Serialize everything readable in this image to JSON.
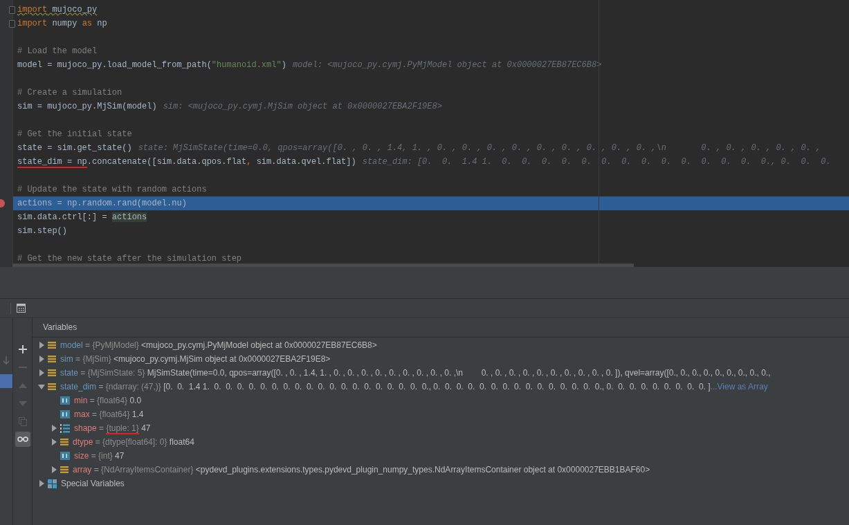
{
  "editor": {
    "lines": [
      {
        "kind": "code",
        "fold": true,
        "current": false,
        "breakpoint": false,
        "tokens": [
          {
            "text": "import",
            "kind": "keyword",
            "squiggle": true
          },
          {
            "text": " mujoco_py",
            "kind": "plain",
            "squiggle": true
          }
        ]
      },
      {
        "kind": "code",
        "fold": true,
        "current": false,
        "breakpoint": false,
        "tokens": [
          {
            "text": "import",
            "kind": "keyword",
            "squiggle": false
          },
          {
            "text": " numpy ",
            "kind": "plain",
            "squiggle": false
          },
          {
            "text": "as",
            "kind": "keyword",
            "squiggle": false
          },
          {
            "text": " np",
            "kind": "plain",
            "squiggle": false
          }
        ]
      },
      {
        "kind": "blank"
      },
      {
        "kind": "code",
        "fold": false,
        "current": false,
        "breakpoint": false,
        "tokens": [
          {
            "text": "# Load the model",
            "kind": "comment"
          }
        ]
      },
      {
        "kind": "code",
        "fold": false,
        "current": false,
        "breakpoint": false,
        "tokens": [
          {
            "text": "model = mujoco_py.load_model_from_path(",
            "kind": "plain"
          },
          {
            "text": "\"humanoid.xml\"",
            "kind": "string"
          },
          {
            "text": ")",
            "kind": "plain"
          }
        ],
        "hint": "model: <mujoco_py.cymj.PyMjModel object at 0x0000027EB87EC6B8>"
      },
      {
        "kind": "blank"
      },
      {
        "kind": "code",
        "fold": false,
        "current": false,
        "breakpoint": false,
        "tokens": [
          {
            "text": "# Create a simulation",
            "kind": "comment"
          }
        ]
      },
      {
        "kind": "code",
        "fold": false,
        "current": false,
        "breakpoint": false,
        "tokens": [
          {
            "text": "sim = mujoco_py.MjSim(model)",
            "kind": "plain"
          }
        ],
        "hint": "sim: <mujoco_py.cymj.MjSim object at 0x0000027EBA2F19E8>"
      },
      {
        "kind": "blank"
      },
      {
        "kind": "code",
        "fold": false,
        "current": false,
        "breakpoint": false,
        "tokens": [
          {
            "text": "# Get the initial state",
            "kind": "comment"
          }
        ]
      },
      {
        "kind": "code",
        "fold": false,
        "current": false,
        "breakpoint": false,
        "tokens": [
          {
            "text": "state = sim.get_state()",
            "kind": "plain"
          }
        ],
        "hint": "state: MjSimState(time=0.0, qpos=array([0. , 0. , 1.4, 1. , 0. , 0. , 0. , 0. , 0. , 0. , 0. , 0. , 0. ,\\n       0. , 0. , 0. , 0. , 0. ,"
      },
      {
        "kind": "code",
        "fold": false,
        "current": false,
        "breakpoint": false,
        "tokens": [
          {
            "text": "state_dim = np",
            "kind": "plain",
            "marked": true
          },
          {
            "text": ".concatenate([sim.data.qpos.flat",
            "kind": "plain",
            "marked": false
          },
          {
            "text": ",",
            "kind": "keyword",
            "marked": false
          },
          {
            "text": " sim.data.qvel.flat])",
            "kind": "plain",
            "marked": false
          }
        ],
        "hint": "state_dim: [0.  0.  1.4 1.  0.  0.  0.  0.  0.  0.  0.  0.  0.  0.  0.  0.  0.  0., 0.  0.  0."
      },
      {
        "kind": "blank"
      },
      {
        "kind": "code",
        "fold": false,
        "current": false,
        "breakpoint": false,
        "tokens": [
          {
            "text": "# Update the state with random actions",
            "kind": "comment"
          }
        ]
      },
      {
        "kind": "code",
        "fold": false,
        "current": true,
        "breakpoint": true,
        "tokens": [
          {
            "text": "actions = np.random.rand(model.nu)",
            "kind": "plain"
          }
        ]
      },
      {
        "kind": "code",
        "fold": false,
        "current": false,
        "breakpoint": false,
        "tokens": [
          {
            "text": "sim.data.ctrl[:] = ",
            "kind": "plain"
          },
          {
            "text": "actions",
            "kind": "usage"
          }
        ]
      },
      {
        "kind": "code",
        "fold": false,
        "current": false,
        "breakpoint": false,
        "tokens": [
          {
            "text": "sim.step()",
            "kind": "plain"
          }
        ]
      },
      {
        "kind": "blank"
      },
      {
        "kind": "code",
        "fold": false,
        "current": false,
        "breakpoint": false,
        "tokens": [
          {
            "text": "# Get the new state after the simulation step",
            "kind": "comment"
          }
        ]
      }
    ]
  },
  "debugger": {
    "title": "Variables",
    "variables": [
      {
        "kind": "object",
        "expandable": true,
        "expanded": false,
        "name": "model",
        "assign": "=",
        "type": "{PyMjModel}",
        "value": "<mujoco_py.cymj.PyMjModel object at 0x0000027EB87EC6B8>"
      },
      {
        "kind": "object",
        "expandable": true,
        "expanded": false,
        "name": "sim",
        "assign": "=",
        "type": "{MjSim}",
        "value": "<mujoco_py.cymj.MjSim object at 0x0000027EBA2F19E8>"
      },
      {
        "kind": "object",
        "expandable": true,
        "expanded": false,
        "name": "state",
        "assign": "=",
        "type": "{MjSimState: 5}",
        "value": "MjSimState(time=0.0, qpos=array([0. , 0. , 1.4, 1. , 0. , 0. , 0. , 0. , 0. , 0. , 0. , 0. , 0. ,\\n        0. , 0. , 0. , 0. , 0. , 0. , 0. , 0. , 0. , 0. ]), qvel=array([0., 0., 0., 0., 0., 0., 0., 0., 0.,"
      },
      {
        "kind": "object",
        "expandable": true,
        "expanded": true,
        "name": "state_dim",
        "assign": "=",
        "type": "{ndarray: (47,)}",
        "value": "[0.  0.  1.4 1.  0.  0.  0.  0.  0.  0.  0.  0.  0.  0.  0.  0.  0.  0.  0.  0.  0.  0.  0., 0.  0.  0.  0.  0.  0.  0.  0.  0.  0.  0.  0.  0.  0.  0., 0.  0.  0.  0.  0.  0.  0.  0.  0. ]",
        "link": "...View as Array",
        "children": [
          {
            "kind": "number",
            "expandable": false,
            "name": "min",
            "assign": "=",
            "type": "{float64}",
            "value": "0.0"
          },
          {
            "kind": "number",
            "expandable": false,
            "name": "max",
            "assign": "=",
            "type": "{float64}",
            "value": "1.4"
          },
          {
            "kind": "tuple",
            "expandable": true,
            "expanded": false,
            "name": "shape",
            "assign": "=",
            "type": "{tuple: 1}",
            "type_marked": true,
            "value": "47"
          },
          {
            "kind": "object",
            "expandable": true,
            "expanded": false,
            "name": "dtype",
            "assign": "=",
            "type": "{dtype[float64]: 0}",
            "value": "float64"
          },
          {
            "kind": "number",
            "expandable": false,
            "name": "size",
            "assign": "=",
            "type": "{int}",
            "value": "47"
          },
          {
            "kind": "object",
            "expandable": true,
            "expanded": false,
            "name": "array",
            "assign": "=",
            "type": "{NdArrayItemsContainer}",
            "value": "<pydevd_plugins.extensions.types.pydevd_plugin_numpy_types.NdArrayItemsContainer object at 0x0000027EBB1BAF60>"
          }
        ]
      },
      {
        "kind": "special",
        "expandable": true,
        "expanded": false,
        "name": "Special Variables"
      }
    ]
  }
}
